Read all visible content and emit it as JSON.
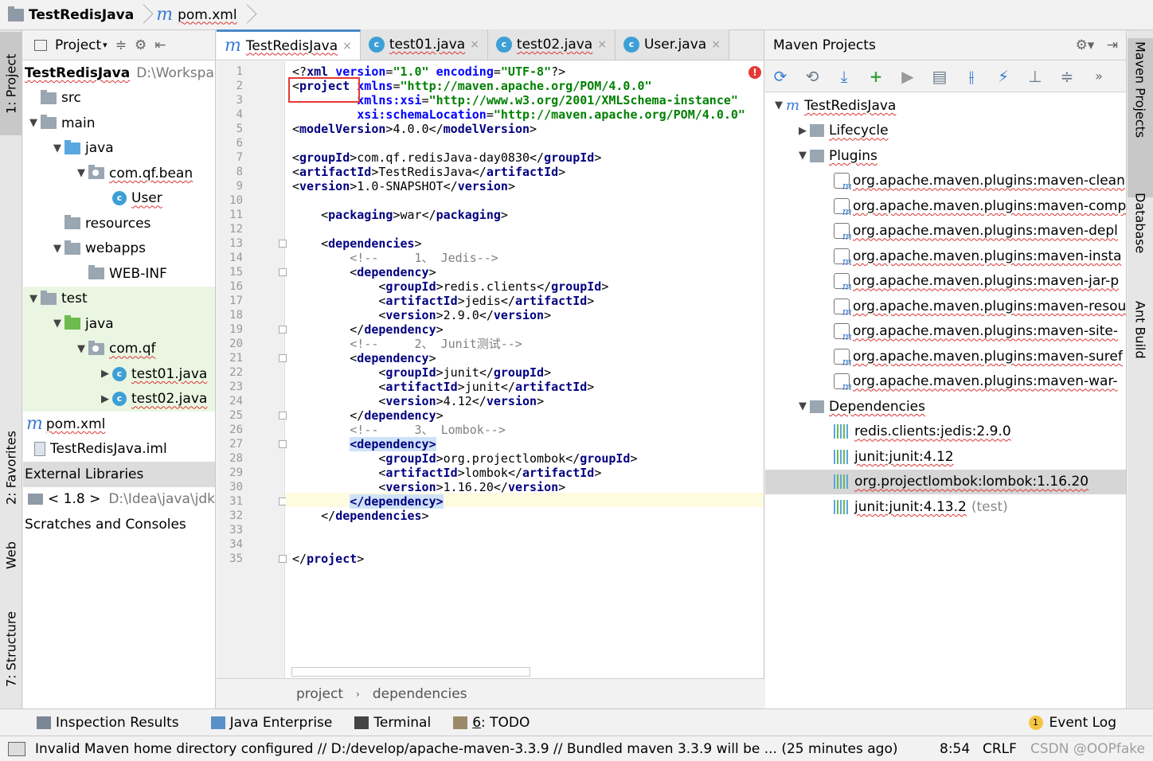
{
  "navbar": {
    "project": "TestRedisJava",
    "file": "pom.xml"
  },
  "left_stripe": {
    "project": "1: Project",
    "favorites": "2: Favorites",
    "web": "Web",
    "structure": "7: Structure"
  },
  "project_panel": {
    "header": "Project",
    "root": {
      "name": "TestRedisJava",
      "path": "D:\\Workspac"
    },
    "items": [
      {
        "label": "src",
        "indent": 0,
        "arrow": "",
        "icon": "folder"
      },
      {
        "label": "main",
        "indent": 0,
        "arrow": "▼",
        "icon": "folder"
      },
      {
        "label": "java",
        "indent": 1,
        "arrow": "▼",
        "icon": "folder-blue"
      },
      {
        "label": "com.qf.bean",
        "indent": 2,
        "arrow": "▼",
        "icon": "package"
      },
      {
        "label": "User",
        "indent": 3,
        "arrow": "",
        "icon": "class"
      },
      {
        "label": "resources",
        "indent": 1,
        "arrow": "",
        "icon": "folder"
      },
      {
        "label": "webapps",
        "indent": 1,
        "arrow": "▼",
        "icon": "folder"
      },
      {
        "label": "WEB-INF",
        "indent": 2,
        "arrow": "",
        "icon": "folder"
      },
      {
        "label": "test",
        "indent": 0,
        "arrow": "▼",
        "icon": "folder"
      },
      {
        "label": "java",
        "indent": 1,
        "arrow": "▼",
        "icon": "folder-green"
      },
      {
        "label": "com.qf",
        "indent": 2,
        "arrow": "▼",
        "icon": "package"
      },
      {
        "label": "test01.java",
        "indent": 3,
        "arrow": "▶",
        "icon": "class"
      },
      {
        "label": "test02.java",
        "indent": 3,
        "arrow": "▶",
        "icon": "class"
      }
    ],
    "pom": "pom.xml",
    "iml": "TestRedisJava.iml",
    "external_libraries": "External Libraries",
    "jdk": {
      "name": "< 1.8 >",
      "path": "D:\\Idea\\java\\jdk"
    },
    "scratches": "Scratches and Consoles"
  },
  "editor": {
    "tabs": [
      {
        "label": "TestRedisJava",
        "icon": "maven",
        "active": true
      },
      {
        "label": "test01.java",
        "icon": "class",
        "active": false
      },
      {
        "label": "test02.java",
        "icon": "class",
        "active": false
      },
      {
        "label": "User.java",
        "icon": "class",
        "active": false
      }
    ],
    "crumbs": [
      "project",
      "dependencies"
    ]
  },
  "maven_panel": {
    "title": "Maven Projects",
    "root": "TestRedisJava",
    "lifecycle": "Lifecycle",
    "plugins": "Plugins",
    "plugin_items": [
      "org.apache.maven.plugins:maven-clean",
      "org.apache.maven.plugins:maven-comp",
      "org.apache.maven.plugins:maven-depl",
      "org.apache.maven.plugins:maven-insta",
      "org.apache.maven.plugins:maven-jar-p",
      "org.apache.maven.plugins:maven-resou",
      "org.apache.maven.plugins:maven-site-",
      "org.apache.maven.plugins:maven-suref",
      "org.apache.maven.plugins:maven-war-"
    ],
    "dependencies": "Dependencies",
    "dependency_items": [
      {
        "label": "redis.clients:jedis:2.9.0",
        "scope": ""
      },
      {
        "label": "junit:junit:4.12",
        "scope": ""
      },
      {
        "label": "org.projectlombok:lombok:1.16.20",
        "scope": ""
      },
      {
        "label": "junit:junit:4.13.2",
        "scope": "(test)"
      }
    ]
  },
  "right_stripe": {
    "maven": "Maven Projects",
    "database": "Database",
    "ant": "Ant Build"
  },
  "bottom_tools": {
    "inspection": "Inspection Results",
    "java_enterprise": "Java Enterprise",
    "terminal": "Terminal",
    "todo_num": "6",
    "todo": ": TODO",
    "event_badge": "1",
    "event_log": "Event Log"
  },
  "status": {
    "message": "Invalid Maven home directory configured // D:/develop/apache-maven-3.3.9 // Bundled maven 3.3.9 will be ... (25 minutes ago)",
    "position": "8:54",
    "line_ending": "CRLF",
    "watermark": "CSDN @OOPfake"
  },
  "colors": {
    "accent": "#4a88c7",
    "error": "#e53935",
    "tag": "#000080",
    "string": "#008000",
    "attribute": "#0000ff"
  }
}
